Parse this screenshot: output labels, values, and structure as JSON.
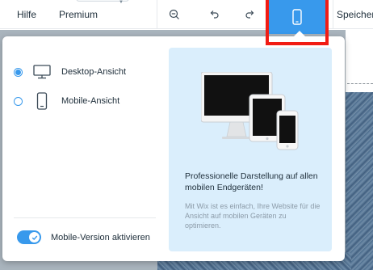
{
  "toolbar": {
    "help_label": "Hilfe",
    "premium_label": "Premium",
    "save_label": "Speicher",
    "zoom_icon": "zoom-out-icon",
    "undo_icon": "undo-icon",
    "redo_icon": "redo-icon",
    "device_icon": "mobile-device-icon",
    "accent_color": "#3899ec",
    "highlight_color": "#f11c14"
  },
  "view_panel": {
    "options": [
      {
        "label": "Desktop-Ansicht",
        "icon": "desktop-monitor-icon",
        "selected": true
      },
      {
        "label": "Mobile-Ansicht",
        "icon": "mobile-phone-icon",
        "selected": false
      }
    ],
    "toggle": {
      "label": "Mobile-Version aktivieren",
      "enabled": true
    }
  },
  "info_card": {
    "illustration": "devices-illustration",
    "title": "Professionelle Darstellung auf allen mobilen Endgeräten!",
    "description": "Mit Wix ist es einfach, Ihre Website für die Ansicht auf mobilen Geräten zu optimieren.",
    "background_color": "#daeefc"
  }
}
